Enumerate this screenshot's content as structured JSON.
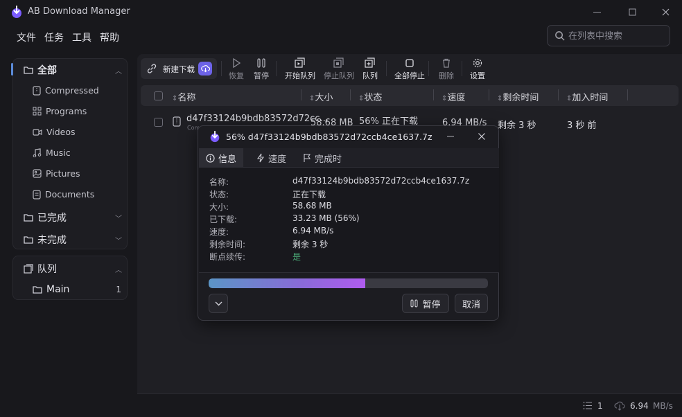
{
  "app": {
    "title": "AB Download Manager"
  },
  "menu": [
    "文件",
    "任务",
    "工具",
    "帮助"
  ],
  "search": {
    "placeholder": "在列表中搜索"
  },
  "sidebar": {
    "all": "全部",
    "categories": [
      "Compressed",
      "Programs",
      "Videos",
      "Music",
      "Pictures",
      "Documents"
    ],
    "completed": "已完成",
    "unfinished": "未完成",
    "queue_header": "队列",
    "queues": [
      {
        "name": "Main",
        "count": "1"
      }
    ]
  },
  "toolbar": {
    "new_download": "新建下载",
    "resume": "恢复",
    "pause": "暂停",
    "start_queue": "开始队列",
    "stop_queue": "停止队列",
    "queue": "队列",
    "stop_all": "全部停止",
    "delete": "删除",
    "settings": "设置"
  },
  "table": {
    "headers": [
      "名称",
      "大小",
      "状态",
      "速度",
      "剩余时间",
      "加入时间"
    ],
    "rows": [
      {
        "name": "d47f33124b9bdb83572d72cc...",
        "sub": "Com",
        "size": "58.68 MB",
        "status": "56% 正在下载",
        "speed": "6.94 MB/s",
        "remaining": "剩余 3 秒",
        "added": "3 秒 前"
      }
    ]
  },
  "statusbar": {
    "count": "1",
    "speed": "6.94",
    "speed_unit": "MB/s"
  },
  "dialog": {
    "title": "56% d47f33124b9bdb83572d72ccb4ce1637.7z",
    "tabs": [
      "信息",
      "速度",
      "完成时"
    ],
    "fields": [
      {
        "label": "名称:",
        "value": "d47f33124b9bdb83572d72ccb4ce1637.7z"
      },
      {
        "label": "状态:",
        "value": "正在下载"
      },
      {
        "label": "大小:",
        "value": "58.68 MB"
      },
      {
        "label": "已下载:",
        "value": "33.23 MB (56%)"
      },
      {
        "label": "速度:",
        "value": "6.94 MB/s"
      },
      {
        "label": "剩余时间:",
        "value": "剩余 3 秒"
      },
      {
        "label": "断点续传:",
        "value": "是"
      }
    ],
    "progress_percent": 56,
    "pause_label": "暂停",
    "cancel_label": "取消"
  },
  "colors": {
    "background": "#18181c",
    "accent": "#5a8ad8",
    "resume_yes": "#4caf7a",
    "progress_start": "#5b95c6",
    "progress_end": "#b05cf0"
  }
}
